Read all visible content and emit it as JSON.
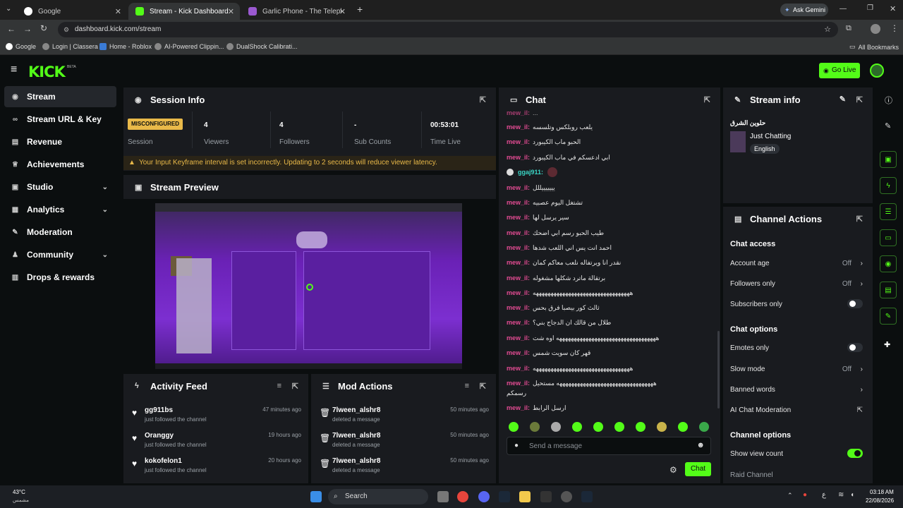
{
  "browser": {
    "tabs": [
      {
        "title": "Google",
        "fav": "#ffffff"
      },
      {
        "title": "Stream - Kick Dashboard",
        "fav": "#53fc18"
      },
      {
        "title": "Garlic Phone - The Telephone C",
        "fav": "#9b59d0"
      }
    ],
    "ask_gemini": "Ask Gemini",
    "url": "dashboard.kick.com/stream",
    "bookmarks": [
      "Google",
      "Login | Classera",
      "Home - Roblox",
      "AI-Powered Clippin...",
      "DualShock Calibrati..."
    ],
    "all_bookmarks": "All Bookmarks"
  },
  "kick": {
    "logo": "KICK",
    "beta": "BETA",
    "go_live": "Go Live",
    "accent": "#53fc18"
  },
  "sidebar": {
    "items": [
      {
        "label": "Stream",
        "icon": "broadcast-icon"
      },
      {
        "label": "Stream URL & Key",
        "icon": "link-icon"
      },
      {
        "label": "Revenue",
        "icon": "revenue-icon"
      },
      {
        "label": "Achievements",
        "icon": "trophy-icon"
      },
      {
        "label": "Studio",
        "icon": "studio-icon"
      },
      {
        "label": "Analytics",
        "icon": "analytics-icon"
      },
      {
        "label": "Moderation",
        "icon": "wrench-icon"
      },
      {
        "label": "Community",
        "icon": "community-icon"
      },
      {
        "label": "Drops & rewards",
        "icon": "gift-icon"
      }
    ]
  },
  "session": {
    "title": "Session Info",
    "badge": "MISCONFIGURED",
    "badge_label": "Session",
    "stats": [
      {
        "value": "4",
        "label": "Viewers"
      },
      {
        "value": "4",
        "label": "Followers"
      },
      {
        "value": "-",
        "label": "Sub Counts"
      },
      {
        "value": "00:53:01",
        "label": "Time Live"
      }
    ],
    "warning": "Your Input Keyframe interval is set incorrectly. Updating to 2 seconds will reduce viewer latency."
  },
  "preview": {
    "title": "Stream Preview"
  },
  "activity": {
    "title": "Activity Feed",
    "rows": [
      {
        "name": "gg911bs",
        "sub": "just followed the channel",
        "time": "47 minutes ago"
      },
      {
        "name": "Oranggy",
        "sub": "just followed the channel",
        "time": "19 hours ago"
      },
      {
        "name": "kokofelon1",
        "sub": "just followed the channel",
        "time": "20 hours ago"
      }
    ]
  },
  "mod": {
    "title": "Mod Actions",
    "rows": [
      {
        "name": "7lween_alshr8",
        "sub": "deleted a message",
        "time": "50 minutes ago"
      },
      {
        "name": "7lween_alshr8",
        "sub": "deleted a message",
        "time": "50 minutes ago"
      },
      {
        "name": "7lween_alshr8",
        "sub": "deleted a message",
        "time": "50 minutes ago"
      }
    ]
  },
  "chat": {
    "title": "Chat",
    "lines": [
      {
        "user": "mew_il:",
        "msg": "يلعب روبلكس وتلسسه"
      },
      {
        "user": "mew_il:",
        "msg": "الحبو ماب الكيبورد"
      },
      {
        "user": "mew_il:",
        "msg": "ابي ادعسكم في ماب الكيبورد"
      },
      {
        "user": "ggaj911:",
        "msg": ""
      },
      {
        "user": "mew_il:",
        "msg": "يييييييللل"
      },
      {
        "user": "mew_il:",
        "msg": "تشتغل اليوم عصبيه"
      },
      {
        "user": "mew_il:",
        "msg": "سير يرسل لها"
      },
      {
        "user": "mew_il:",
        "msg": "طيب الحبو رسم ابي اضحك"
      },
      {
        "user": "mew_il:",
        "msg": "احمد انت يس اني اللعب شدها"
      },
      {
        "user": "mew_il:",
        "msg": "نقدر انا ويرتفاله نلعب معاكم كمان"
      },
      {
        "user": "mew_il:",
        "msg": "برتقالة ماترد شكلها مشغوله"
      },
      {
        "user": "mew_il:",
        "msg": "هههههههههههههههههههههههههههههههههه"
      },
      {
        "user": "mew_il:",
        "msg": "ثالث كور بيصبا فرق بحس"
      },
      {
        "user": "mew_il:",
        "msg": "طلال من قالك ان الدجاج بني؟"
      },
      {
        "user": "mew_il:",
        "msg": "ههههههههههههههههههههههههههههههههههه اوه شت"
      },
      {
        "user": "mew_il:",
        "msg": "قهر كان سويت شمس"
      },
      {
        "user": "mew_il:",
        "msg": "هههههههههههههههههههههههههههههههههه"
      },
      {
        "user": "mew_il:",
        "msg": "هههههههههههههههههههههههههههههههههه مستحيل"
      },
      {
        "user": "mew_il:",
        "msg": "ارسل الرابط"
      }
    ],
    "extra_wrap": "رسمكم",
    "placeholder": "Send a message",
    "send": "Chat"
  },
  "stream_info": {
    "title": "Stream info",
    "stream_title": "حلوين الشرق",
    "category": "Just Chatting",
    "tag": "English"
  },
  "channel_actions": {
    "title": "Channel Actions",
    "chat_access": "Chat access",
    "account_age": {
      "label": "Account age",
      "value": "Off"
    },
    "followers_only": {
      "label": "Followers only",
      "value": "Off"
    },
    "subscribers_only": {
      "label": "Subscribers only"
    },
    "chat_options": "Chat options",
    "emotes_only": {
      "label": "Emotes only"
    },
    "slow_mode": {
      "label": "Slow mode",
      "value": "Off"
    },
    "banned_words": {
      "label": "Banned words"
    },
    "ai_mod": {
      "label": "AI Chat Moderation"
    },
    "channel_options": "Channel options",
    "show_view_count": {
      "label": "Show view count"
    },
    "raid": {
      "label": "Raid Channel"
    }
  },
  "taskbar": {
    "weather_temp": "43°C",
    "weather_desc": "مشمس",
    "search": "Search",
    "lang": "ع",
    "time": "03:18 AM",
    "date": "22/08/2026"
  }
}
